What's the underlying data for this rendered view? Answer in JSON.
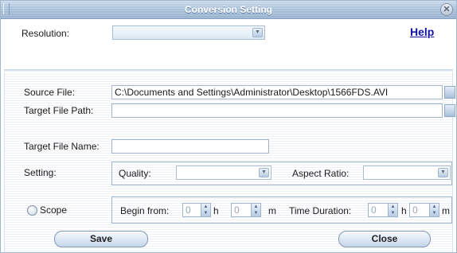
{
  "window": {
    "title": "Conversion Setting",
    "close_icon": "close-icon"
  },
  "top": {
    "resolution_label": "Resolution:",
    "resolution_value": "",
    "help_label": "Help"
  },
  "files": {
    "source_label": "Source File:",
    "source_value": "C:\\Documents and Settings\\Administrator\\Desktop\\1566FDS.AVI",
    "target_path_label": "Target File Path:",
    "target_path_value": "",
    "target_name_label": "Target File Name:",
    "target_name_value": ""
  },
  "setting": {
    "label": "Setting:",
    "quality_label": "Quality:",
    "quality_value": "",
    "aspect_label": "Aspect Ratio:",
    "aspect_value": ""
  },
  "scope": {
    "label": "Scope",
    "checked": false,
    "begin_label": "Begin from:",
    "begin_h": "0",
    "begin_h_unit": "h",
    "begin_m": "0",
    "begin_m_unit": "m",
    "duration_label": "Time Duration:",
    "duration_h": "0",
    "duration_h_unit": "h",
    "duration_m": "0",
    "duration_m_unit": "m"
  },
  "buttons": {
    "save": "Save",
    "close": "Close"
  },
  "colors": {
    "title_bar": "#a9c0d9",
    "help_link": "#1414a6",
    "border": "#9fb5cd"
  }
}
